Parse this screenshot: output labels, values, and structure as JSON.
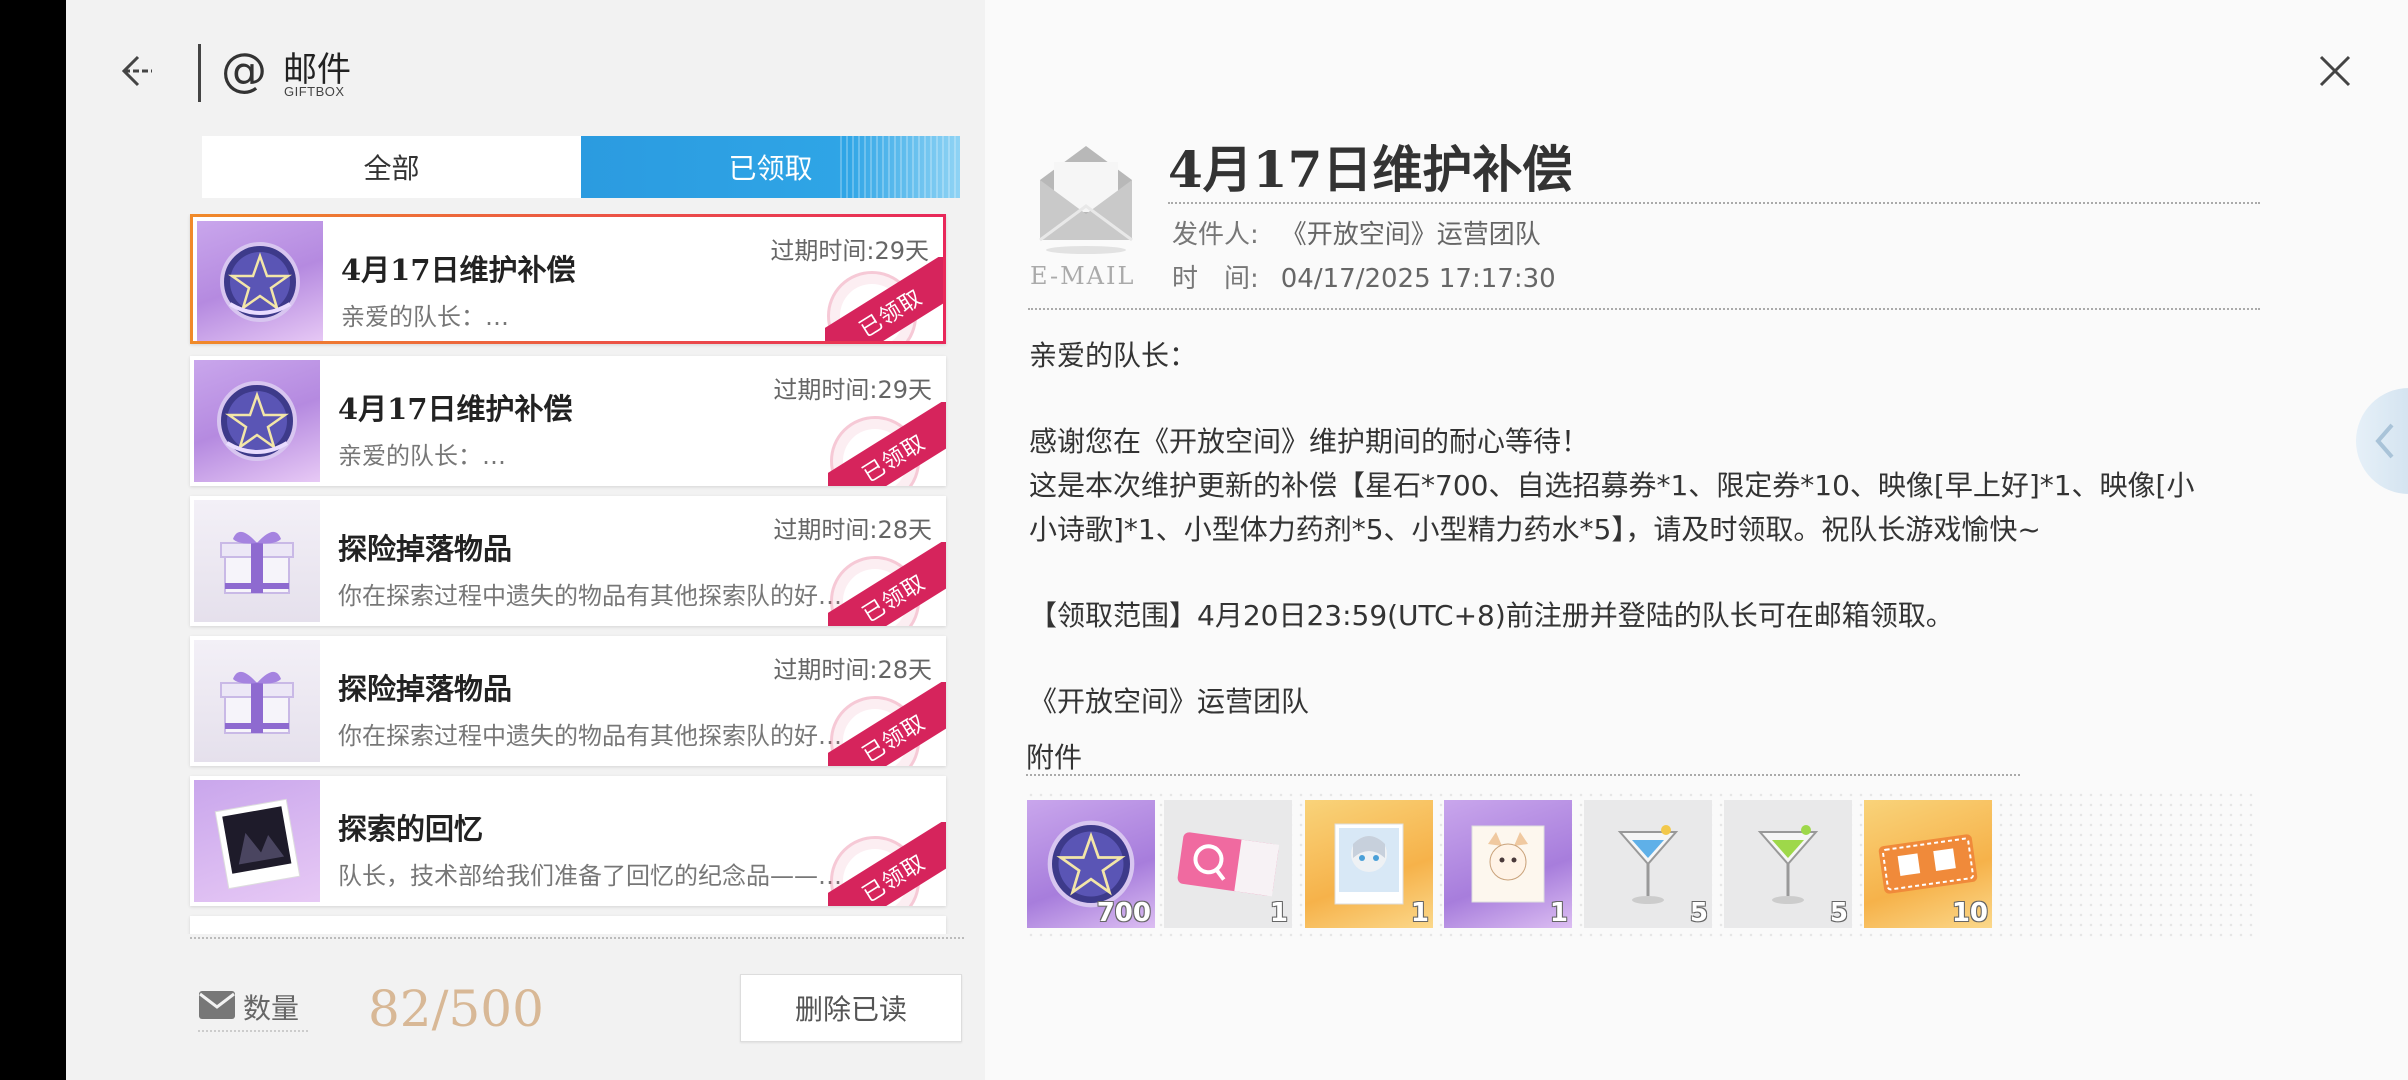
{
  "header": {
    "title": "邮件",
    "subtitle": "GIFTBOX"
  },
  "tabs": [
    {
      "label": "全部",
      "active": false
    },
    {
      "label": "已领取",
      "active": true
    }
  ],
  "mails": [
    {
      "title": "4月17日维护补偿",
      "preview": "亲爱的队长：…",
      "expire": "过期时间:29天",
      "stamp": "已领取",
      "thumb": "crystal-ball"
    },
    {
      "title": "4月17日维护补偿",
      "preview": "亲爱的队长：…",
      "expire": "过期时间:29天",
      "stamp": "已领取",
      "thumb": "crystal-ball"
    },
    {
      "title": "探险掉落物品",
      "preview": "你在探索过程中遗失的物品有其他探索队的好…",
      "expire": "过期时间:28天",
      "stamp": "已领取",
      "thumb": "gift-box"
    },
    {
      "title": "探险掉落物品",
      "preview": "你在探索过程中遗失的物品有其他探索队的好…",
      "expire": "过期时间:28天",
      "stamp": "已领取",
      "thumb": "gift-box"
    },
    {
      "title": "探索的回忆",
      "preview": "队长，技术部给我们准备了回忆的纪念品——…",
      "expire": "",
      "stamp": "已领取",
      "thumb": "photo"
    }
  ],
  "footer": {
    "count_label": "数量",
    "count_value": "82/500",
    "delete_label": "删除已读"
  },
  "detail": {
    "email_label": "E-MAIL",
    "title": "4月17日维护补偿",
    "sender_label": "发件人:",
    "sender": "《开放空间》运营团队",
    "time_label": "时　间:",
    "time": "04/17/2025 17:17:30",
    "body": [
      "亲爱的队长：",
      "感谢您在《开放空间》维护期间的耐心等待！",
      "这是本次维护更新的补偿【星石*700、自选招募券*1、限定券*10、映像[早上好]*1、映像[小",
      "小诗歌]*1、小型体力药剂*5、小型精力药水*5】，请及时领取。祝队长游戏愉快~",
      "【领取范围】4月20日23:59(UTC+8)前注册并登陆的队长可在邮箱领取。",
      "《开放空间》运营团队"
    ],
    "attach_label": "附件",
    "attachments": [
      {
        "icon": "star-stone-icon",
        "qty": "700"
      },
      {
        "icon": "recruit-ticket-icon",
        "qty": "1"
      },
      {
        "icon": "image-card-morning-icon",
        "qty": "1"
      },
      {
        "icon": "image-card-poem-icon",
        "qty": "1"
      },
      {
        "icon": "stamina-potion-icon",
        "qty": "5"
      },
      {
        "icon": "energy-potion-icon",
        "qty": "5"
      },
      {
        "icon": "limited-ticket-icon",
        "qty": "10"
      }
    ]
  },
  "colors": {
    "accent_blue": "#2b9be0",
    "stamp_red": "#d6245c",
    "count_gold": "#d8b896"
  }
}
